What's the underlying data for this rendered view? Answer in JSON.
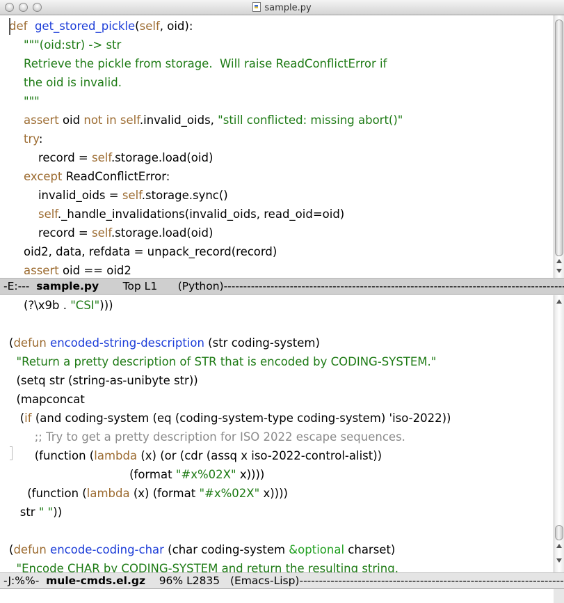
{
  "window": {
    "title": "sample.py"
  },
  "pane1": {
    "lines": [
      [
        [
          "kw",
          "def"
        ],
        [
          "",
          "  "
        ],
        [
          "fn",
          "get_stored_pickle"
        ],
        [
          "",
          "("
        ],
        [
          "kw",
          "self"
        ],
        [
          "",
          ", oid):"
        ]
      ],
      [
        [
          "",
          "    "
        ],
        [
          "st",
          "\"\"\"(oid:str) -> str"
        ]
      ],
      [
        [
          "",
          "    "
        ],
        [
          "st",
          "Retrieve the pickle from storage.  Will raise ReadConflictError if"
        ]
      ],
      [
        [
          "",
          "    "
        ],
        [
          "st",
          "the oid is invalid."
        ]
      ],
      [
        [
          "",
          "    "
        ],
        [
          "st",
          "\"\"\""
        ]
      ],
      [
        [
          "",
          "    "
        ],
        [
          "kw",
          "assert"
        ],
        [
          "",
          " oid "
        ],
        [
          "kw",
          "not in"
        ],
        [
          "kw",
          " self"
        ],
        [
          "",
          ".invalid_oids, "
        ],
        [
          "st",
          "\"still conflicted: missing abort()\""
        ]
      ],
      [
        [
          "",
          "    "
        ],
        [
          "kw",
          "try"
        ],
        [
          "",
          ":"
        ]
      ],
      [
        [
          "",
          "        record = "
        ],
        [
          "kw",
          "self"
        ],
        [
          "",
          ".storage.load(oid)"
        ]
      ],
      [
        [
          "",
          "    "
        ],
        [
          "kw",
          "except"
        ],
        [
          "",
          " ReadConflictError:"
        ]
      ],
      [
        [
          "",
          "        invalid_oids = "
        ],
        [
          "kw",
          "self"
        ],
        [
          "",
          ".storage.sync()"
        ]
      ],
      [
        [
          "",
          "        "
        ],
        [
          "kw",
          "self"
        ],
        [
          "",
          "._handle_invalidations(invalid_oids, read_oid=oid)"
        ]
      ],
      [
        [
          "",
          "        record = "
        ],
        [
          "kw",
          "self"
        ],
        [
          "",
          ".storage.load(oid)"
        ]
      ],
      [
        [
          "",
          "    oid2, data, refdata = unpack_record(record)"
        ]
      ],
      [
        [
          "",
          "    "
        ],
        [
          "kw",
          "assert"
        ],
        [
          "",
          " oid == oid2"
        ]
      ]
    ]
  },
  "modeline1": {
    "prefix": "-E:---  ",
    "buffer": "sample.py",
    "position": "       Top L1      ",
    "mode": "(Python)",
    "fill": "------------------------------------------------------------------------------------------------"
  },
  "pane2": {
    "lines": [
      [
        [
          "",
          "    (?\\x9b . "
        ],
        [
          "st",
          "\"CSI\""
        ],
        [
          "",
          ")))"
        ]
      ],
      [
        [
          "",
          ""
        ]
      ],
      [
        [
          "",
          "("
        ],
        [
          "kw",
          "defun"
        ],
        [
          "",
          " "
        ],
        [
          "fn",
          "encoded-string-description"
        ],
        [
          "",
          " (str coding-system)"
        ]
      ],
      [
        [
          "",
          "  "
        ],
        [
          "st",
          "\"Return a pretty description of STR that is encoded by CODING-SYSTEM.\""
        ]
      ],
      [
        [
          "",
          "  (setq str (string-as-unibyte str))"
        ]
      ],
      [
        [
          "",
          "  (mapconcat"
        ]
      ],
      [
        [
          "",
          "   ("
        ],
        [
          "kw",
          "if"
        ],
        [
          "",
          " (and coding-system (eq (coding-system-type coding-system) 'iso-2022))"
        ]
      ],
      [
        [
          "",
          "       "
        ],
        [
          "cm",
          ";; Try to get a pretty description for ISO 2022 escape sequences."
        ]
      ],
      [
        [
          "",
          "       (function ("
        ],
        [
          "kw",
          "lambda"
        ],
        [
          "",
          " (x) (or (cdr (assq x iso-2022-control-alist))"
        ]
      ],
      [
        [
          "",
          "                                 (format "
        ],
        [
          "st",
          "\"#x%02X\""
        ],
        [
          "",
          " x))))"
        ]
      ],
      [
        [
          "",
          "     (function ("
        ],
        [
          "kw",
          "lambda"
        ],
        [
          "",
          " (x) (format "
        ],
        [
          "st",
          "\"#x%02X\""
        ],
        [
          "",
          " x))))"
        ]
      ],
      [
        [
          "",
          "   str "
        ],
        [
          "st",
          "\" \""
        ],
        [
          "",
          "))"
        ]
      ],
      [
        [
          "",
          ""
        ]
      ],
      [
        [
          "",
          "("
        ],
        [
          "kw",
          "defun"
        ],
        [
          "",
          " "
        ],
        [
          "fn",
          "encode-coding-char"
        ],
        [
          "",
          " (char coding-system "
        ],
        [
          "ty",
          "&optional"
        ],
        [
          "",
          " charset)"
        ]
      ],
      [
        [
          "",
          "  "
        ],
        [
          "st",
          "\"Encode CHAR by CODING-SYSTEM and return the resulting string."
        ]
      ]
    ]
  },
  "modeline2": {
    "prefix": "-J:%%-  ",
    "buffer": "mule-cmds.el.gz",
    "position": "    96% L2835   ",
    "mode": "(Emacs-Lisp)",
    "fill": "------------------------------------------------------------------------------------------------"
  },
  "icons": {
    "close": "close-icon",
    "minimize": "minimize-icon",
    "zoom": "zoom-icon",
    "file": "python-file-icon"
  }
}
